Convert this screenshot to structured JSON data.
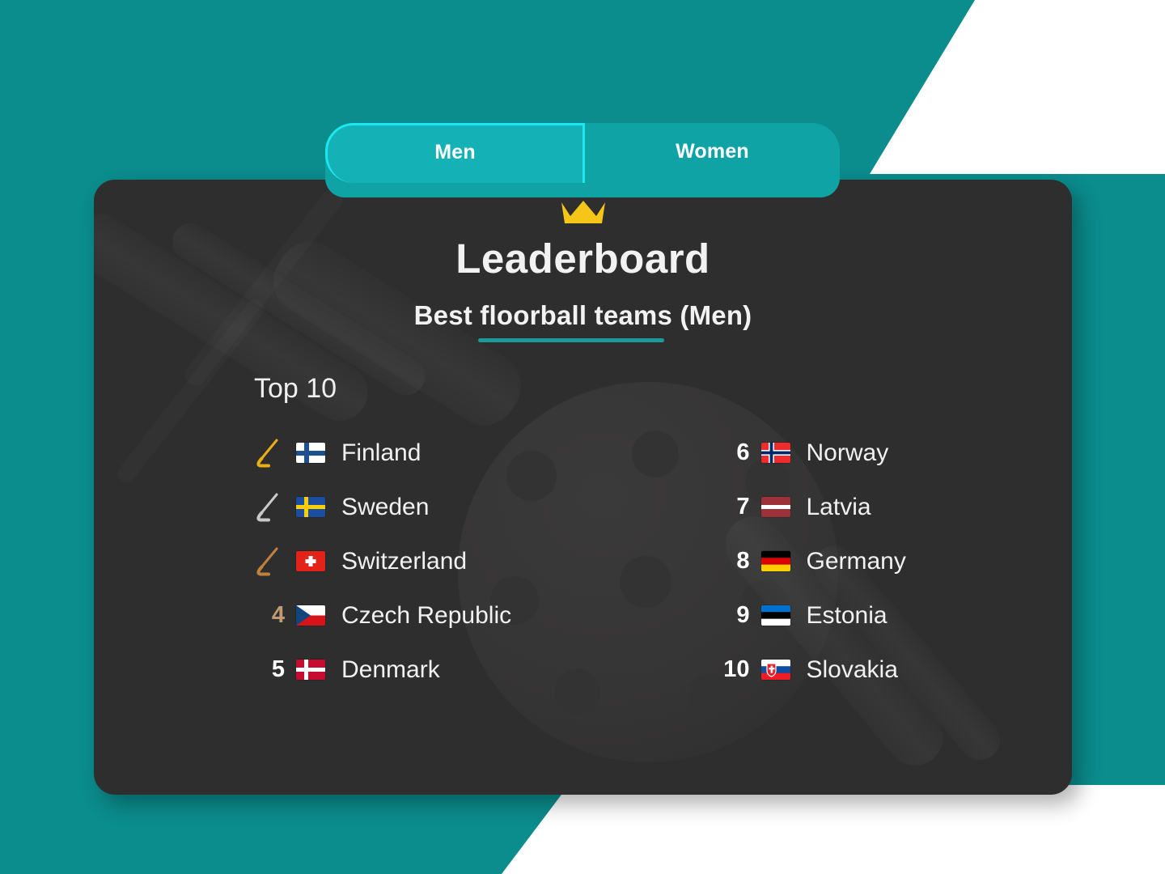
{
  "theme": {
    "teal_bg": "#0b8c8d",
    "tabbar_bg": "#0fa3a5",
    "tab_active_bg": "#14b2b6",
    "tab_active_border": "#1ce7f0",
    "card_bg": "#2f2e2e",
    "underline_teal": "#1b9b9c",
    "crown_gold": "#f5c518",
    "gold": "#e8b014",
    "silver": "#c9c9c9",
    "bronze": "#bf8040",
    "bronze_number": "#c09a72",
    "text_white": "#f1f1f1"
  },
  "tabs": [
    {
      "label": "Men",
      "active": true
    },
    {
      "label": "Women",
      "active": false
    }
  ],
  "header": {
    "crown_icon": "crown-icon",
    "title": "Leaderboard",
    "subtitle": "Best floorball teams (Men)"
  },
  "list": {
    "section_label": "Top 10",
    "left": [
      {
        "rank": "1",
        "medal": "gold",
        "flag": "fi",
        "country": "Finland"
      },
      {
        "rank": "2",
        "medal": "silver",
        "flag": "se",
        "country": "Sweden"
      },
      {
        "rank": "3",
        "medal": "bronze",
        "flag": "ch",
        "country": "Switzerland"
      },
      {
        "rank": "4",
        "medal": "none",
        "flag": "cz",
        "country": "Czech Republic"
      },
      {
        "rank": "5",
        "medal": "none",
        "flag": "dk",
        "country": "Denmark"
      }
    ],
    "right": [
      {
        "rank": "6",
        "medal": "none",
        "flag": "no",
        "country": "Norway"
      },
      {
        "rank": "7",
        "medal": "none",
        "flag": "lv",
        "country": "Latvia"
      },
      {
        "rank": "8",
        "medal": "none",
        "flag": "de",
        "country": "Germany"
      },
      {
        "rank": "9",
        "medal": "none",
        "flag": "ee",
        "country": "Estonia"
      },
      {
        "rank": "10",
        "medal": "none",
        "flag": "sk",
        "country": "Slovakia"
      }
    ]
  }
}
